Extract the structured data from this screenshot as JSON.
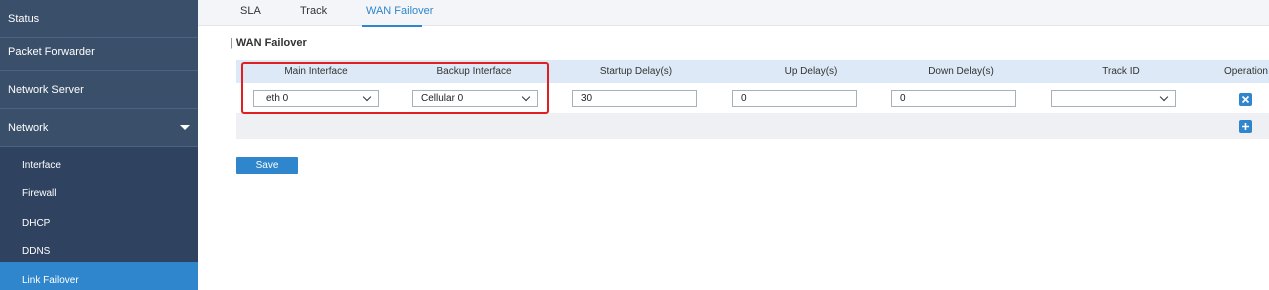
{
  "sidebar": {
    "items": [
      {
        "label": "Status"
      },
      {
        "label": "Packet Forwarder"
      },
      {
        "label": "Network Server"
      },
      {
        "label": "Network"
      }
    ],
    "subitems": [
      {
        "label": "Interface"
      },
      {
        "label": "Firewall"
      },
      {
        "label": "DHCP"
      },
      {
        "label": "DDNS"
      },
      {
        "label": "Link Failover",
        "active": true
      }
    ]
  },
  "tabs": [
    {
      "label": "SLA"
    },
    {
      "label": "Track"
    },
    {
      "label": "WAN Failover",
      "active": true
    }
  ],
  "section": {
    "title": "WAN Failover"
  },
  "table": {
    "headers": [
      "Main Interface",
      "Backup Interface",
      "Startup Delay(s)",
      "Up Delay(s)",
      "Down Delay(s)",
      "Track ID",
      "Operation"
    ],
    "row": {
      "main_interface": "eth 0",
      "backup_interface": "Cellular 0",
      "startup_delay": "30",
      "up_delay": "0",
      "down_delay": "0",
      "track_id": ""
    }
  },
  "actions": {
    "delete_icon": "close-icon",
    "add_icon": "plus-icon",
    "save_label": "Save"
  },
  "colors": {
    "sidebar_bg": "#3a4f6a",
    "active_blue": "#2f86cc",
    "highlight_red": "#e02020"
  }
}
